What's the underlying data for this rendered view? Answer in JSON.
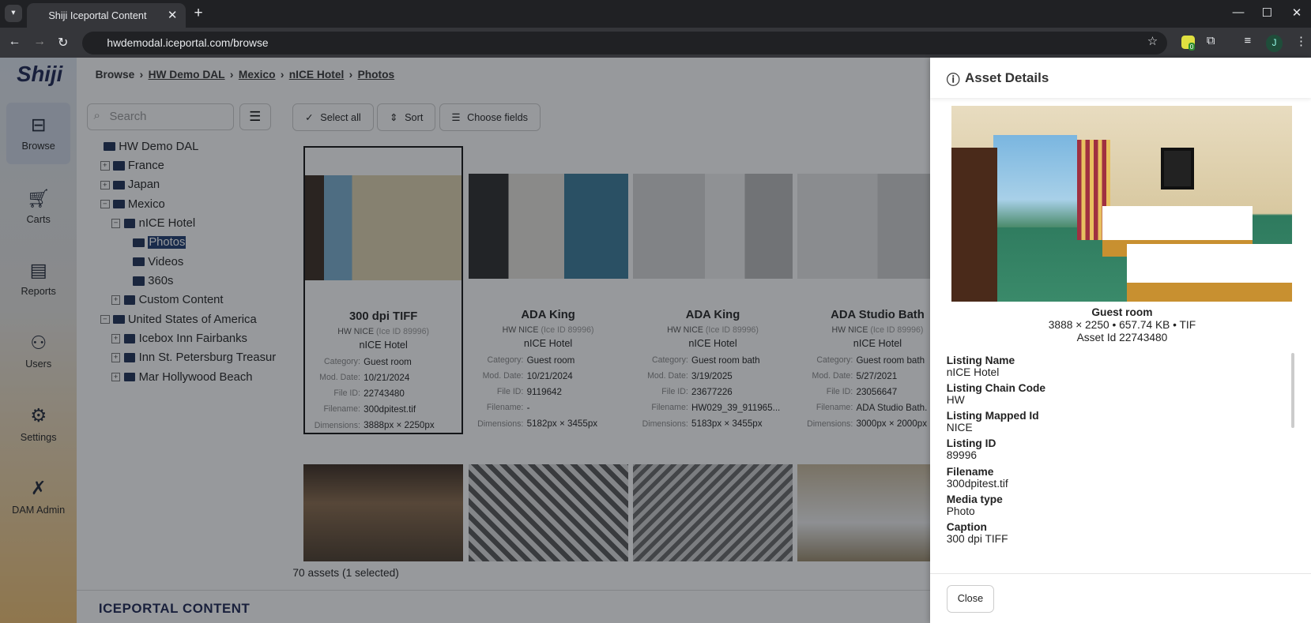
{
  "browser": {
    "tab_title": "Shiji Iceportal Content",
    "url": "hwdemodal.iceportal.com/browse",
    "extension_badge": "0",
    "profile": "J"
  },
  "app": {
    "logo": "Shiji",
    "footer_logo": "ICEPORTAL CONTENT",
    "nav": [
      {
        "label": "Browse",
        "icon": "browse-icon"
      },
      {
        "label": "Carts",
        "icon": "cart-icon"
      },
      {
        "label": "Reports",
        "icon": "report-icon"
      },
      {
        "label": "Users",
        "icon": "users-icon"
      },
      {
        "label": "Settings",
        "icon": "gear-icon"
      },
      {
        "label": "DAM Admin",
        "icon": "tools-icon"
      }
    ],
    "breadcrumb": [
      "Browse",
      "HW Demo DAL",
      "Mexico",
      "nICE Hotel",
      "Photos"
    ],
    "search_placeholder": "Search",
    "tree": [
      {
        "label": "HW Demo DAL",
        "level": 0,
        "toggle": ""
      },
      {
        "label": "France",
        "level": 0,
        "toggle": "+"
      },
      {
        "label": "Japan",
        "level": 0,
        "toggle": "+"
      },
      {
        "label": "Mexico",
        "level": 0,
        "toggle": "-"
      },
      {
        "label": "nICE Hotel",
        "level": 1,
        "toggle": "-"
      },
      {
        "label": "Photos",
        "level": 2,
        "toggle": "",
        "selected": true
      },
      {
        "label": "Videos",
        "level": 2,
        "toggle": ""
      },
      {
        "label": "360s",
        "level": 2,
        "toggle": ""
      },
      {
        "label": "Custom Content",
        "level": 1,
        "toggle": "+"
      },
      {
        "label": "United States of America",
        "level": 0,
        "toggle": "-"
      },
      {
        "label": "Icebox Inn Fairbanks",
        "level": 1,
        "toggle": "+"
      },
      {
        "label": "Inn St. Petersburg Treasur",
        "level": 1,
        "toggle": "+"
      },
      {
        "label": "Mar Hollywood Beach",
        "level": 1,
        "toggle": "+"
      }
    ],
    "toolbar": {
      "select_all": "Select all",
      "sort": "Sort",
      "choose_fields": "Choose fields"
    },
    "field_labels": {
      "category": "Category:",
      "mod_date": "Mod. Date:",
      "file_id": "File ID:",
      "filename": "Filename:",
      "dimensions": "Dimensions:"
    },
    "cards": [
      {
        "title": "300 dpi TIFF",
        "chain": "HW NICE",
        "ice": "(Ice ID 89996)",
        "hotel": "nICE Hotel",
        "category": "Guest room",
        "mod_date": "10/21/2024",
        "file_id": "22743480",
        "filename": "300dpitest.tif",
        "dimensions": "3888px × 2250px"
      },
      {
        "title": "ADA King",
        "chain": "HW NICE",
        "ice": "(Ice ID 89996)",
        "hotel": "nICE Hotel",
        "category": "Guest room",
        "mod_date": "10/21/2024",
        "file_id": "9119642",
        "filename": "-",
        "dimensions": "5182px × 3455px"
      },
      {
        "title": "ADA King",
        "chain": "HW NICE",
        "ice": "(Ice ID 89996)",
        "hotel": "nICE Hotel",
        "category": "Guest room bath",
        "mod_date": "3/19/2025",
        "file_id": "23677226",
        "filename": "HW029_39_911965...",
        "dimensions": "5183px × 3455px"
      },
      {
        "title": "ADA Studio Bath",
        "chain": "HW NICE",
        "ice": "(Ice ID 89996)",
        "hotel": "nICE Hotel",
        "category": "Guest room bath",
        "mod_date": "5/27/2021",
        "file_id": "23056647",
        "filename": "ADA Studio Bath.",
        "dimensions": "3000px × 2000px"
      }
    ],
    "asset_count": "70 assets (1 selected)"
  },
  "panel": {
    "title": "Asset Details",
    "caption": "Guest room",
    "meta": "3888 × 2250 • 657.74 KB • TIF",
    "asset_id": "Asset Id 22743480",
    "fields": [
      {
        "k": "Listing Name",
        "v": "nICE Hotel"
      },
      {
        "k": "Listing Chain Code",
        "v": "HW"
      },
      {
        "k": "Listing Mapped Id",
        "v": "NICE"
      },
      {
        "k": "Listing ID",
        "v": "89996"
      },
      {
        "k": "Filename",
        "v": "300dpitest.tif"
      },
      {
        "k": "Media type",
        "v": "Photo"
      },
      {
        "k": "Caption",
        "v": "300 dpi TIFF"
      }
    ],
    "close": "Close"
  }
}
